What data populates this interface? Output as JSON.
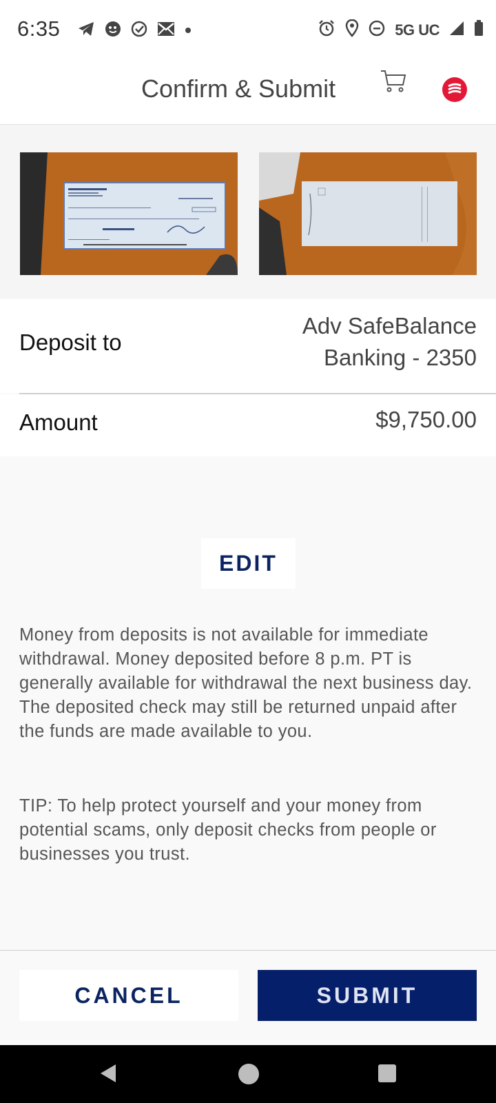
{
  "status_bar": {
    "time": "6:35",
    "network": "5G UC",
    "left_icons": [
      "telegram-icon",
      "face-icon",
      "check-circle-icon",
      "mail-icon",
      "dot-icon"
    ],
    "right_icons": [
      "alarm-icon",
      "location-icon",
      "do-not-disturb-icon",
      "signal-icon",
      "battery-icon"
    ]
  },
  "header": {
    "title": "Confirm & Submit",
    "cart_icon": "cart-icon",
    "logo_icon": "bank-logo-icon",
    "logo_color": "#e31837"
  },
  "check_images": {
    "front": {
      "name_line": "PAUL CAMACLANG",
      "bank": "BANK OF AMERICA",
      "date": "10/21/2024"
    },
    "back": {}
  },
  "deposit": {
    "label": "Deposit to",
    "value_line1": "Adv SafeBalance",
    "value_line2": "Banking - 2350"
  },
  "amount": {
    "label": "Amount",
    "value": "$9,750.00"
  },
  "edit_label": "EDIT",
  "disclaimer": "Money from deposits is not available for immediate withdrawal. Money deposited before 8 p.m. PT is generally available for withdrawal the next business day. The deposited check may still be returned unpaid after the funds are made available to you.",
  "tip": "TIP: To help protect yourself and your money from potential scams, only deposit checks from people or businesses you trust.",
  "footer": {
    "cancel_label": "CANCEL",
    "submit_label": "SUBMIT"
  },
  "colors": {
    "primary": "#061f6b",
    "accent_text": "#0b2461",
    "brand_red": "#e31837"
  }
}
